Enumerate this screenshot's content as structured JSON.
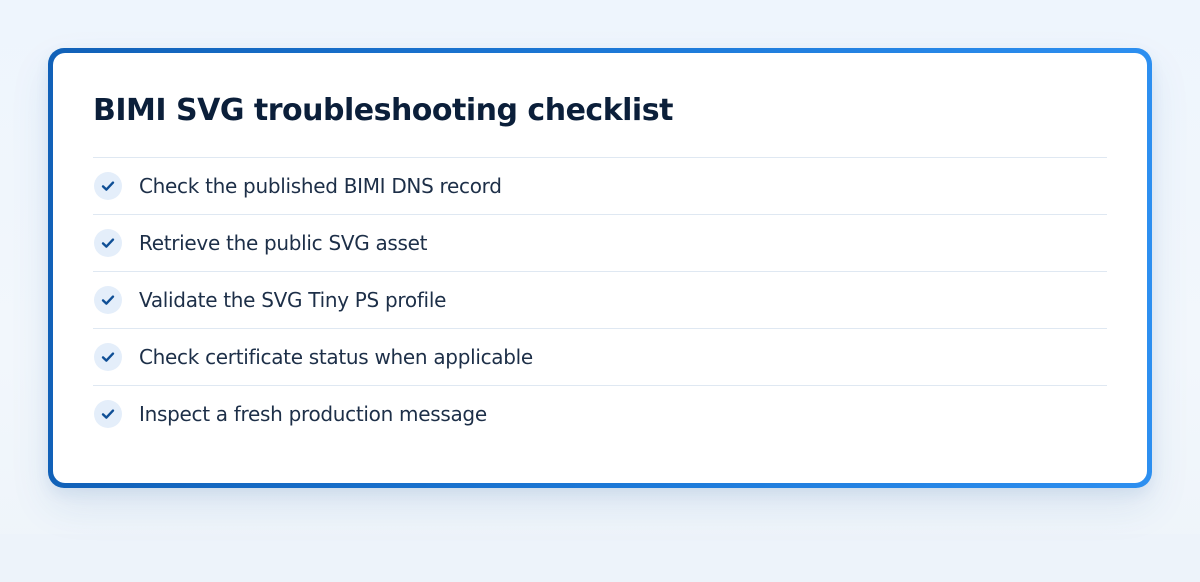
{
  "card": {
    "title": "BIMI SVG troubleshooting checklist",
    "items": [
      {
        "label": "Check the published BIMI DNS record",
        "checked": true,
        "icon": "check-icon"
      },
      {
        "label": "Retrieve the public SVG asset",
        "checked": true,
        "icon": "check-icon"
      },
      {
        "label": "Validate the SVG Tiny PS profile",
        "checked": true,
        "icon": "check-icon"
      },
      {
        "label": "Check certificate status when applicable",
        "checked": true,
        "icon": "check-icon"
      },
      {
        "label": "Inspect a fresh production message",
        "checked": true,
        "icon": "check-icon"
      }
    ]
  },
  "colors": {
    "accent": "#1a6fcf",
    "check": "#0f4f96",
    "title": "#0b1f3a",
    "text": "#1d2f48",
    "divider": "#dfe8f2",
    "badge": "#e4eefa"
  }
}
